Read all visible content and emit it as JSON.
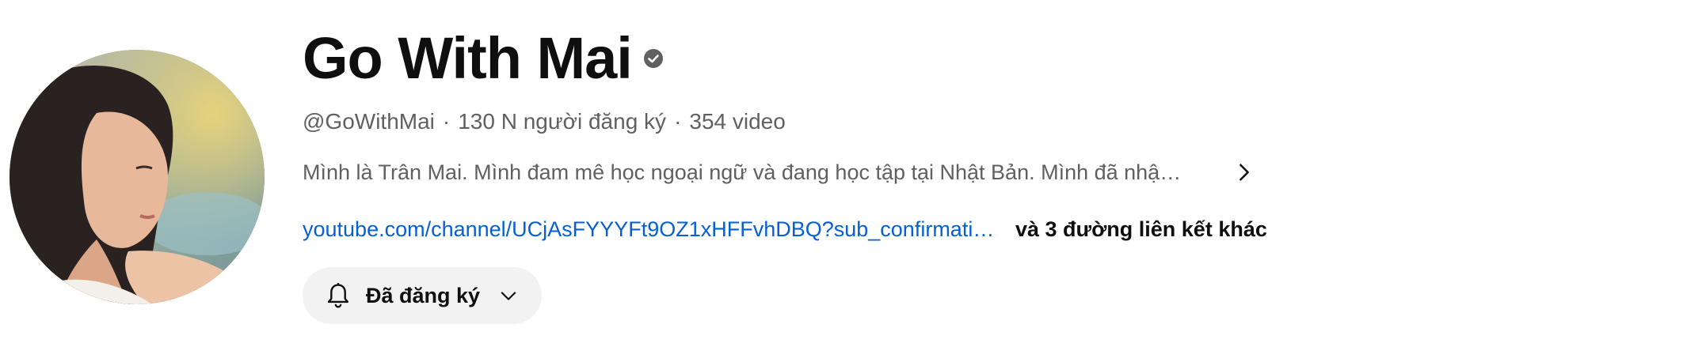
{
  "channel": {
    "name": "Go With Mai",
    "handle": "@GoWithMai",
    "separator": "·",
    "subscribers": "130 N người đăng ký",
    "videos": "354 video"
  },
  "description": {
    "text": "Mình là Trân Mai. Mình đam mê học ngoại ngữ và đang học tập tại Nhật Bản. Mình đã nhậ…"
  },
  "links": {
    "url_text": "youtube.com/channel/UCjAsFYYYFt9OZ1xHFFvhDBQ?sub_confirmati…",
    "more_text": "và 3 đường liên kết khác"
  },
  "subscribe_button": {
    "label": "Đã đăng ký"
  },
  "icons": {
    "verified": "verified-check-icon",
    "description_more": "chevron-right-icon",
    "bell": "bell-icon",
    "dropdown": "chevron-down-icon"
  },
  "colors": {
    "link": "#065fd4",
    "muted_text": "#606060",
    "button_bg": "#f2f2f2",
    "title": "#0f0f0f"
  }
}
